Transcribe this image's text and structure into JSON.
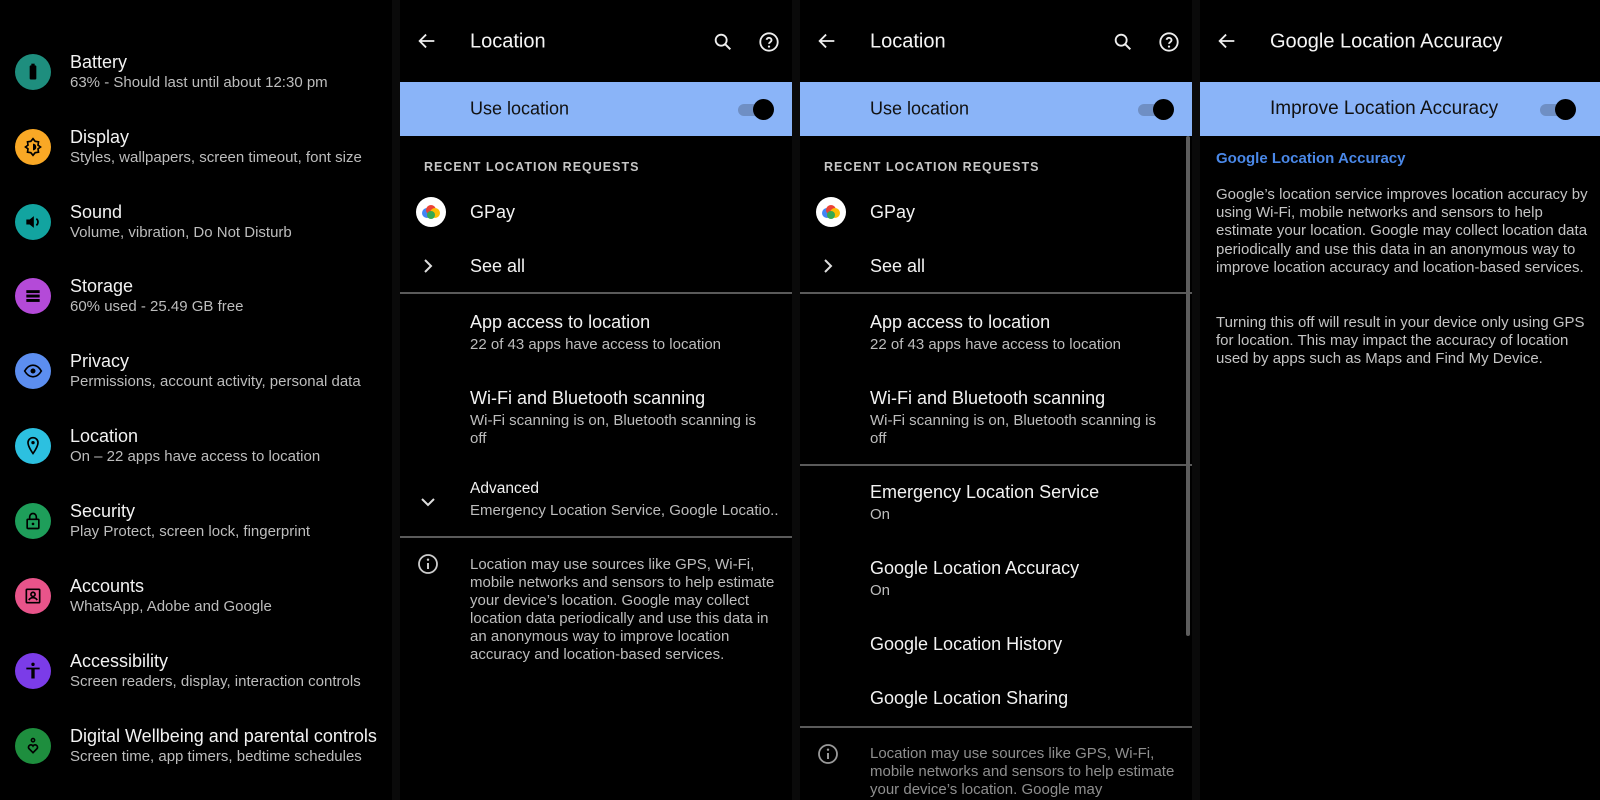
{
  "settings_list": {
    "items": [
      {
        "title": "Battery",
        "subtitle": "63% - Should last until about 12:30 pm",
        "icon": "battery-icon",
        "color": "#1e8e7e"
      },
      {
        "title": "Display",
        "subtitle": "Styles, wallpapers, screen timeout, font size",
        "icon": "brightness-icon",
        "color": "#f9a825"
      },
      {
        "title": "Sound",
        "subtitle": "Volume, vibration, Do Not Disturb",
        "icon": "volume-icon",
        "color": "#12a4a0"
      },
      {
        "title": "Storage",
        "subtitle": "60% used - 25.49 GB free",
        "icon": "storage-icon",
        "color": "#b44ad8"
      },
      {
        "title": "Privacy",
        "subtitle": "Permissions, account activity, personal data",
        "icon": "privacy-eye-icon",
        "color": "#5c8ef0"
      },
      {
        "title": "Location",
        "subtitle": "On – 22 apps have access to location",
        "icon": "location-pin-icon",
        "color": "#2cc0e0"
      },
      {
        "title": "Security",
        "subtitle": "Play Protect, screen lock, fingerprint",
        "icon": "lock-icon",
        "color": "#1e9e5a"
      },
      {
        "title": "Accounts",
        "subtitle": "WhatsApp, Adobe and Google",
        "icon": "account-box-icon",
        "color": "#e8548a"
      },
      {
        "title": "Accessibility",
        "subtitle": "Screen readers, display, interaction controls",
        "icon": "accessibility-icon",
        "color": "#7b3ce8"
      },
      {
        "title": "Digital Wellbeing and parental controls",
        "subtitle": "Screen time, app timers, bedtime schedules",
        "icon": "wellbeing-icon",
        "color": "#1e8e3e"
      }
    ]
  },
  "location_screen": {
    "title": "Location",
    "use_location_label": "Use location",
    "use_location_on": true,
    "recent_header": "RECENT LOCATION REQUESTS",
    "recent_apps": [
      {
        "name": "GPay"
      }
    ],
    "see_all": "See all",
    "app_access": {
      "title": "App access to location",
      "subtitle": "22 of 43 apps have access to location"
    },
    "scanning": {
      "title": "Wi-Fi and Bluetooth scanning",
      "subtitle": "Wi-Fi scanning is on, Bluetooth scanning is off"
    },
    "advanced": {
      "title": "Advanced",
      "subtitle": "Emergency Location Service, Google Locatio.."
    },
    "info": "Location may use sources like GPS, Wi-Fi, mobile networks and sensors to help estimate your device’s location. Google may collect location data periodically and use this data in an anonymous way to improve location accuracy and location-based services."
  },
  "location_expanded": {
    "title": "Location",
    "use_location_label": "Use location",
    "recent_header": "RECENT LOCATION REQUESTS",
    "recent_apps": [
      {
        "name": "GPay"
      }
    ],
    "see_all": "See all",
    "app_access": {
      "title": "App access to location",
      "subtitle": "22 of 43 apps have access to location"
    },
    "scanning": {
      "title": "Wi-Fi and Bluetooth scanning",
      "subtitle": "Wi-Fi scanning is on, Bluetooth scanning is off"
    },
    "advanced_items": [
      {
        "title": "Emergency Location Service",
        "subtitle": "On"
      },
      {
        "title": "Google Location Accuracy",
        "subtitle": "On"
      },
      {
        "title": "Google Location History",
        "subtitle": ""
      },
      {
        "title": "Google Location Sharing",
        "subtitle": ""
      }
    ],
    "info": "Location may use sources like GPS, Wi-Fi, mobile networks and sensors to help estimate your device’s location. Google may"
  },
  "accuracy_screen": {
    "title": "Google Location Accuracy",
    "toggle_label": "Improve Location Accuracy",
    "toggle_on": true,
    "heading": "Google Location Accuracy",
    "paragraph1": "Google’s location service improves location accuracy by using Wi-Fi, mobile networks and sensors to help estimate your location. Google may collect location data periodically and use this data in an anonymous way to improve location accuracy and location-based services.",
    "paragraph2": "Turning this off will result in your device only using GPS for location. This may impact the accuracy of location used by apps such as Maps and Find My Device."
  },
  "colors": {
    "accent": "#8ab4f8",
    "link_blue": "#4a88e8"
  }
}
